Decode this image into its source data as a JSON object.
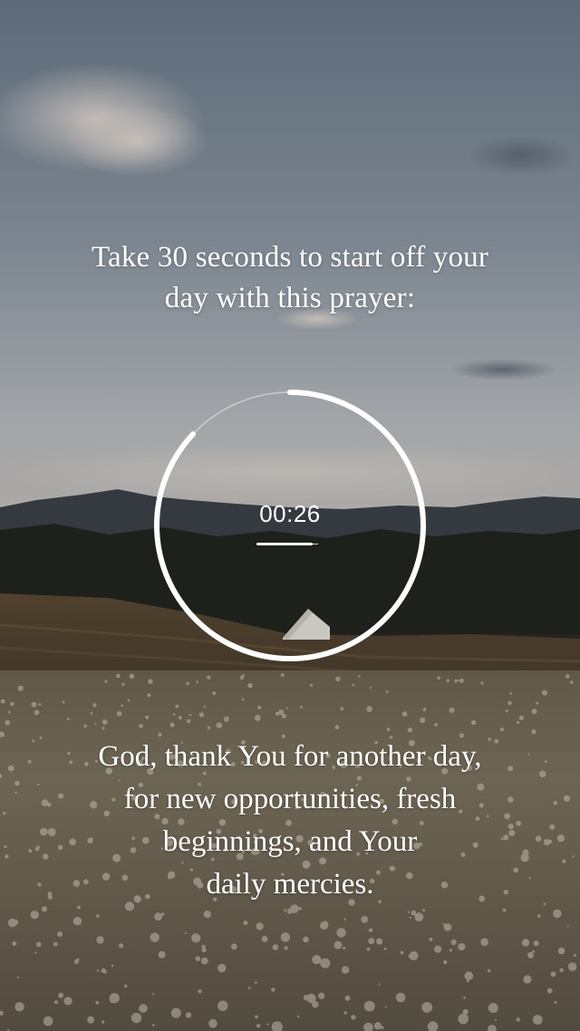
{
  "intro": {
    "lines": [
      "Take 30 seconds to start off your",
      "day with this prayer:"
    ]
  },
  "timer": {
    "display": "00:26",
    "progress": 0.13
  },
  "prayer": {
    "lines": [
      "God, thank You for another day,",
      "for new opportunities, fresh",
      "beginnings, and Your",
      "daily mercies."
    ]
  },
  "colors": {
    "sky_top": "#6f7f8f",
    "sky_bottom": "#b7bcc2",
    "hills": "#3c4047",
    "forest": "#25271f",
    "field": "#6b5a42",
    "meadow": "#8a7f6c",
    "text": "#ffffff"
  }
}
